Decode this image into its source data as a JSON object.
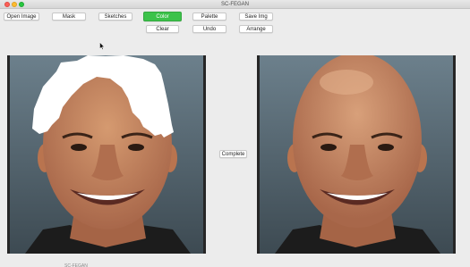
{
  "window": {
    "title": "SC-FEGAN"
  },
  "toolbar": {
    "open_image": "Open Image",
    "mask": "Mask",
    "sketches": "Sketches",
    "color": "Color",
    "palette": "Palette",
    "save_img": "Save Img",
    "clear": "Clear",
    "undo": "Undo",
    "arrange": "Arrange"
  },
  "main": {
    "complete_label": "Complete"
  },
  "footer": {
    "cut_text": "SC-FEGAN"
  },
  "colors": {
    "active_button": "#3cc24a",
    "mask_fill": "#ffffff",
    "panel_border": "#262626",
    "skin": "#c98a62",
    "background": "#ececec"
  },
  "icons": [
    "arrow-cursor-icon"
  ]
}
